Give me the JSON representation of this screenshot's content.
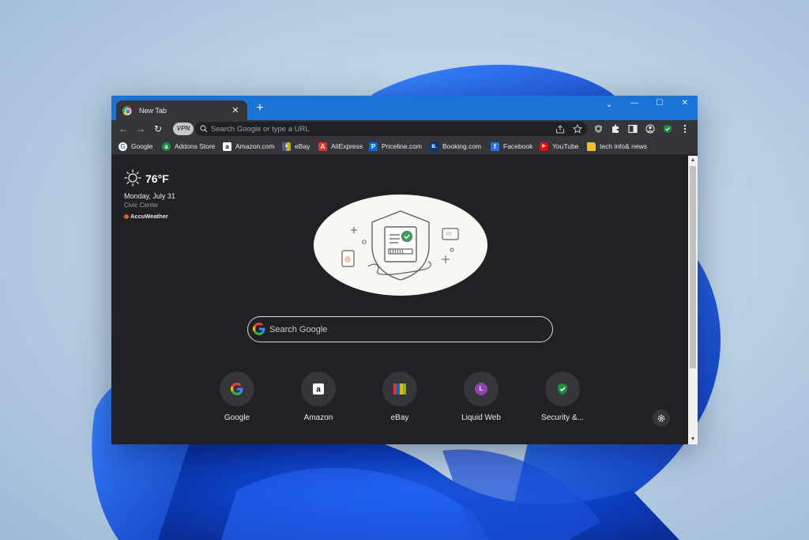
{
  "browser": {
    "tab": {
      "title": "New Tab",
      "close": "✕"
    },
    "new_tab": "+",
    "window_controls": {
      "chevron": "⌄",
      "minimize": "—",
      "maximize": "☐",
      "close": "✕"
    }
  },
  "toolbar": {
    "back": "←",
    "forward": "→",
    "reload": "↻",
    "vpn_label": "VPN",
    "omnibox_placeholder": "Search Google or type a URL",
    "icons": [
      "share-icon",
      "star-icon",
      "extension-shield-icon",
      "puzzle-icon",
      "side-panel-icon",
      "profile-icon",
      "vpn-check-icon",
      "menu-icon"
    ]
  },
  "bookmarks": [
    {
      "label": "Google",
      "icon": "G",
      "color": "#ffffff",
      "fg": "#4285f4"
    },
    {
      "label": "Addons Store",
      "icon": "a",
      "color": "#1e8e3e",
      "fg": "#ffffff"
    },
    {
      "label": "Amazon.com",
      "icon": "a",
      "color": "#ffffff",
      "fg": "#000000"
    },
    {
      "label": "eBay",
      "icon": "e",
      "color": "#e53238",
      "fg": "#ffffff"
    },
    {
      "label": "AliExpress",
      "icon": "A",
      "color": "#e43225",
      "fg": "#ffffff"
    },
    {
      "label": "Priceline.com",
      "icon": "P",
      "color": "#0068ef",
      "fg": "#ffffff"
    },
    {
      "label": "Booking.com",
      "icon": "B.",
      "color": "#003580",
      "fg": "#ffffff"
    },
    {
      "label": "Facebook",
      "icon": "f",
      "color": "#1877f2",
      "fg": "#ffffff"
    },
    {
      "label": "YouTube",
      "icon": "▶",
      "color": "#ff0000",
      "fg": "#ffffff"
    },
    {
      "label": "tech info& news",
      "icon": "",
      "color": "#f6c026",
      "fg": "#000000"
    }
  ],
  "weather": {
    "temp": "76°F",
    "date": "Monday, July 31",
    "location": "Civic Center",
    "brand": "AccuWeather"
  },
  "search": {
    "placeholder": "Search Google"
  },
  "shortcuts": [
    {
      "label": "Google"
    },
    {
      "label": "Amazon"
    },
    {
      "label": "eBay"
    },
    {
      "label": "Liquid Web",
      "letter": "L"
    },
    {
      "label": "Security &..."
    }
  ],
  "colors": {
    "titlebar": "#1a73d6",
    "toolbar": "#35363a",
    "page": "#202124",
    "accent_check": "#34a853"
  }
}
